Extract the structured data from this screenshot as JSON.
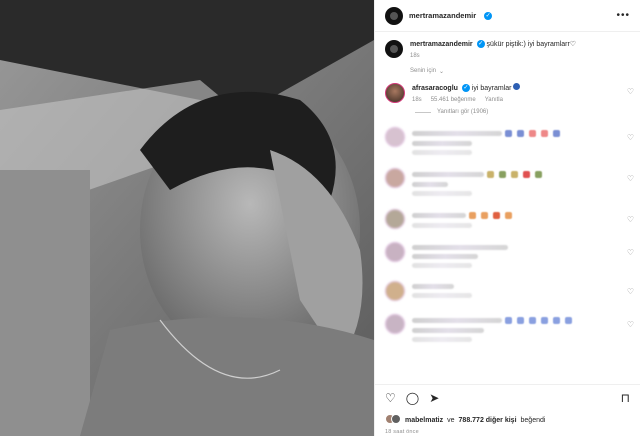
{
  "post": {
    "username": "mertramazandemir",
    "more_label": "•••"
  },
  "caption": {
    "username": "mertramazandemir",
    "text": "şükür piştik:) iyi bayramlarr♡",
    "time": "18s",
    "for_you": "Senin için"
  },
  "comments": [
    {
      "username": "afrasaracoglu",
      "text": "iyi bayramlar",
      "time": "18s",
      "likes": "55.461 beğenme",
      "reply": "Yanıtla",
      "view_replies": "Yanıtları gör (1906)"
    }
  ],
  "blurred_rows": [
    {
      "avatar_color": "#d7c2d0",
      "emoji_colors": [
        "#7a8fd4",
        "#7a8fd4",
        "#e88",
        "#e88",
        "#7a8fd4"
      ]
    },
    {
      "avatar_color": "#c9a8a0",
      "emoji_colors": [
        "#c9b26a",
        "#88a060",
        "#c9b26a",
        "#e05050",
        "#88a060"
      ]
    },
    {
      "avatar_color": "#b4a898",
      "emoji_colors": [
        "#e9a060",
        "#e9a060",
        "#e06040",
        "#e9a060"
      ]
    },
    {
      "avatar_color": "#c8b2c2",
      "emoji_colors": []
    },
    {
      "avatar_color": "#d0b08c",
      "emoji_colors": []
    },
    {
      "avatar_color": "#c8b4c4",
      "emoji_colors": [
        "#8aa0e0",
        "#8aa0e0",
        "#8aa0e0",
        "#8aa0e0",
        "#8aa0e0",
        "#8aa0e0"
      ]
    }
  ],
  "actions": {
    "like_icon": "heart-icon",
    "comment_icon": "comment-icon",
    "share_icon": "share-icon",
    "save_icon": "bookmark-icon"
  },
  "likes": {
    "user": "mabelmatiz",
    "connector": "ve",
    "count": "788.772 diğer kişi",
    "suffix": "beğendi"
  },
  "posted": "18 saat önce",
  "colors": {
    "verified": "#0095f6",
    "muted": "#8e8e8e"
  }
}
